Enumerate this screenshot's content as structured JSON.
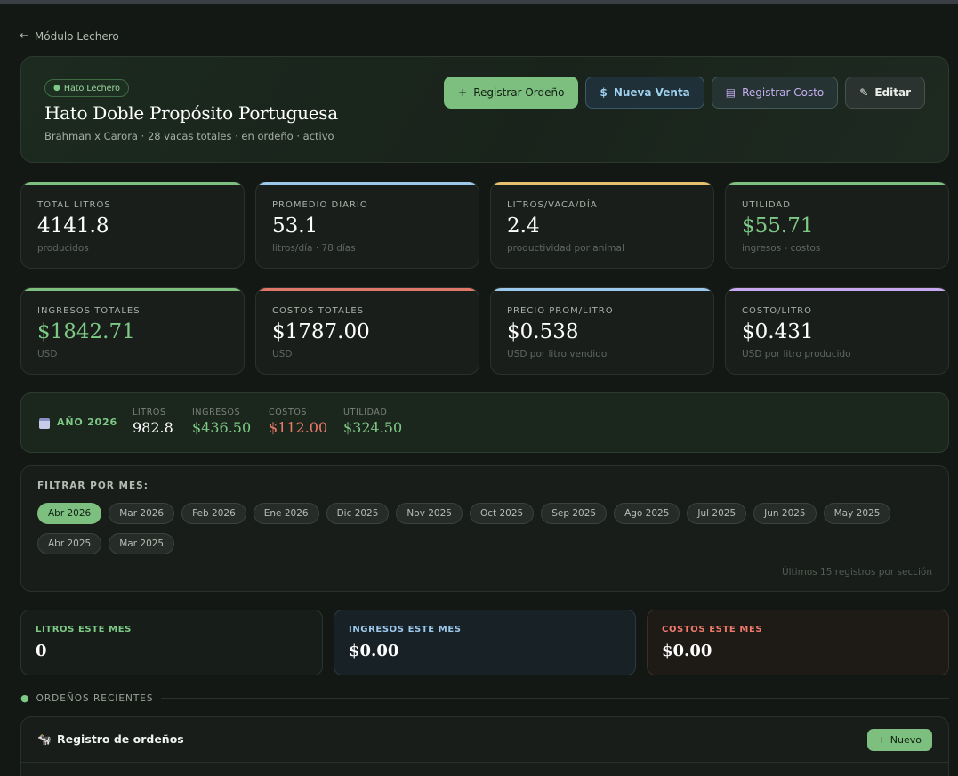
{
  "nav": {
    "back_label": "Módulo Lechero"
  },
  "hero": {
    "badge": "Hato Lechero",
    "title": "Hato Doble Propósito Portuguesa",
    "subtitle": "Brahman x Carora · 28 vacas totales · en ordeño · activo",
    "actions": {
      "registrar_ordeno": "Registrar Ordeño",
      "nueva_venta": "Nueva Venta",
      "registrar_costo": "Registrar Costo",
      "editar": "Editar"
    }
  },
  "stats": [
    {
      "label": "TOTAL LITROS",
      "value": "4141.8",
      "sub": "producidos",
      "accent": "#7dbf7f"
    },
    {
      "label": "PROMEDIO DIARIO",
      "value": "53.1",
      "sub": "litros/día · 78 días",
      "accent": "#9cc8ec"
    },
    {
      "label": "LITROS/VACA/DÍA",
      "value": "2.4",
      "sub": "productividad por animal",
      "accent": "#e8c070"
    },
    {
      "label": "UTILIDAD",
      "value": "$55.71",
      "sub": "ingresos - costos",
      "accent": "#7dbf7f"
    },
    {
      "label": "INGRESOS TOTALES",
      "value": "$1842.71",
      "sub": "USD",
      "accent": "#7dbf7f"
    },
    {
      "label": "COSTOS TOTALES",
      "value": "$1787.00",
      "sub": "USD",
      "accent": "#e0786a"
    },
    {
      "label": "PRECIO PROM/LITRO",
      "value": "$0.538",
      "sub": "USD por litro vendido",
      "accent": "#9cc8ec"
    },
    {
      "label": "COSTO/LITRO",
      "value": "$0.431",
      "sub": "USD por litro producido",
      "accent": "#c8a8f0"
    }
  ],
  "year_summary": {
    "label": "AÑO 2026",
    "litros_label": "LITROS",
    "litros": "982.8",
    "ingresos_label": "INGRESOS",
    "ingresos": "$436.50",
    "costos_label": "COSTOS",
    "costos": "$112.00",
    "utilidad_label": "UTILIDAD",
    "utilidad": "$324.50"
  },
  "filter": {
    "title": "FILTRAR POR MES:",
    "months": [
      "Abr 2026",
      "Mar 2026",
      "Feb 2026",
      "Ene 2026",
      "Dic 2025",
      "Nov 2025",
      "Oct 2025",
      "Sep 2025",
      "Ago 2025",
      "Jul 2025",
      "Jun 2025",
      "May 2025",
      "Abr 2025",
      "Mar 2025"
    ],
    "selected": "Abr 2026",
    "note": "Últimos 15 registros por sección"
  },
  "month_boxes": {
    "litros_label": "LITROS ESTE MES",
    "litros": "0",
    "ingresos_label": "INGRESOS ESTE MES",
    "ingresos": "$0.00",
    "costos_label": "COSTOS ESTE MES",
    "costos": "$0.00"
  },
  "recent": {
    "section_title": "ORDEÑOS RECIENTES",
    "card_title": "Registro de ordeños",
    "new_label": "Nuevo"
  },
  "colors": {
    "accent_green": "#7dbf7f",
    "blue": "#9cc8ec",
    "red": "#e0786a",
    "purple": "#c8a8f0",
    "amber": "#e8c070"
  }
}
